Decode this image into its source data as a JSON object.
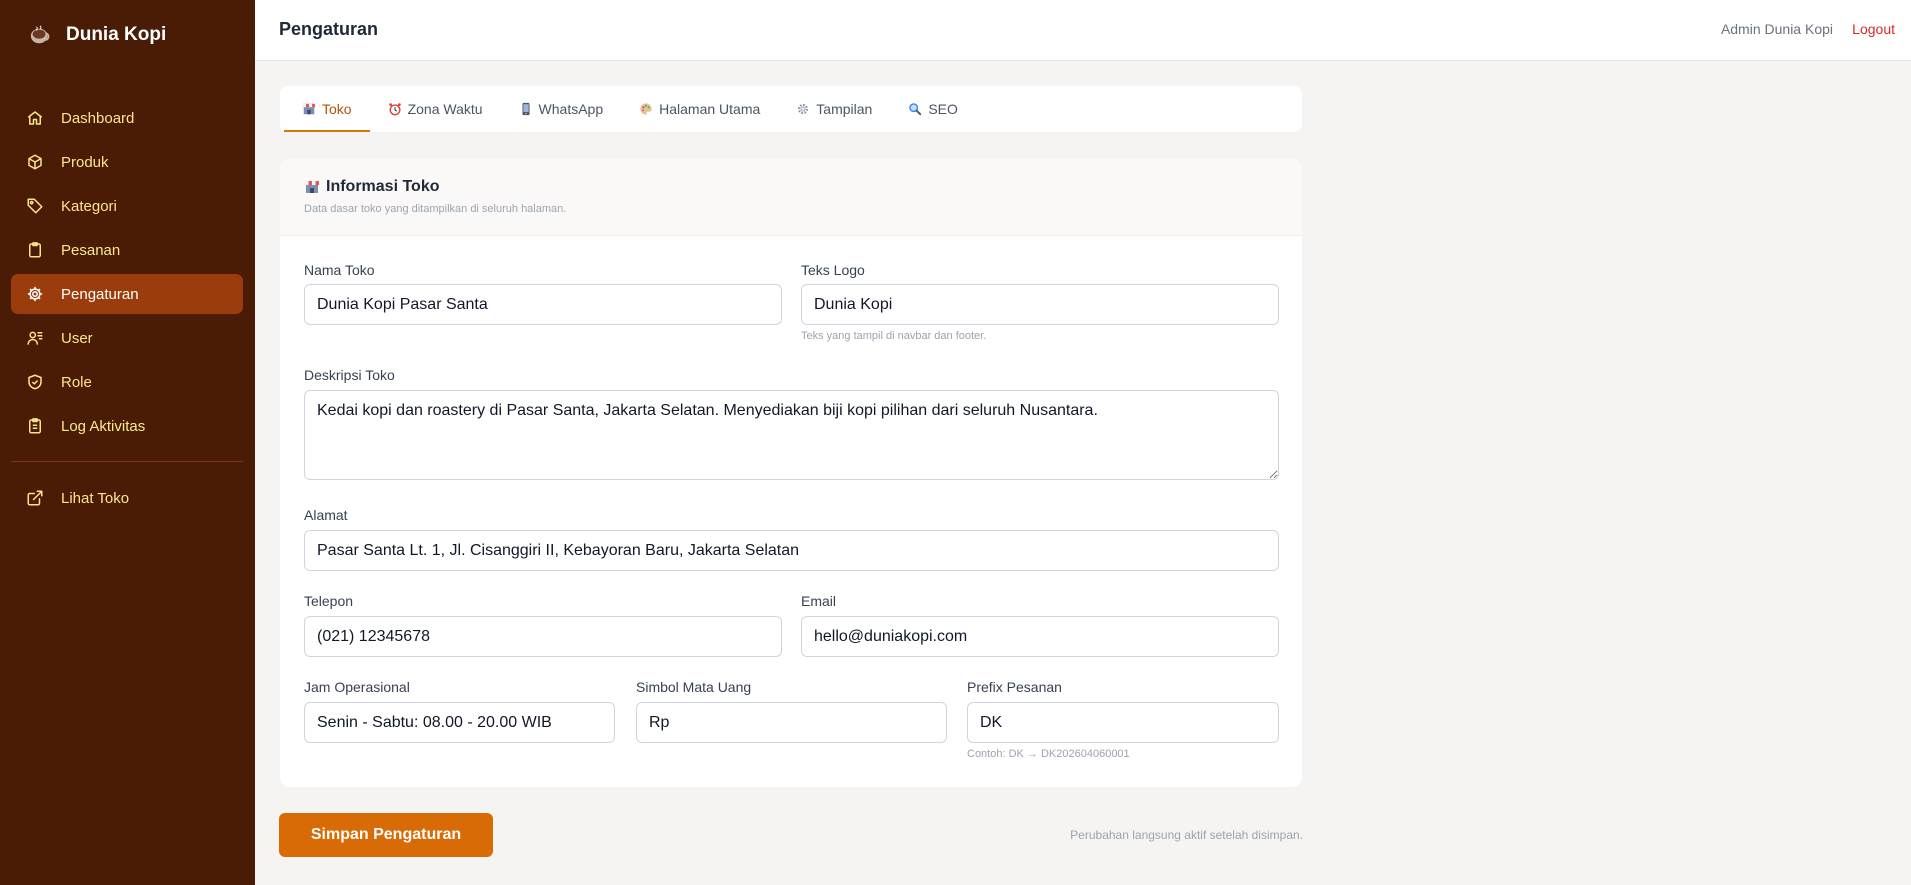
{
  "brand": {
    "name": "Dunia Kopi",
    "icon": "coffee-cup-icon"
  },
  "sidebar": {
    "items": [
      {
        "label": "Dashboard",
        "icon": "home-icon",
        "active": false
      },
      {
        "label": "Produk",
        "icon": "box-icon",
        "active": false
      },
      {
        "label": "Kategori",
        "icon": "tag-icon",
        "active": false
      },
      {
        "label": "Pesanan",
        "icon": "clipboard-icon",
        "active": false
      },
      {
        "label": "Pengaturan",
        "icon": "gear-icon",
        "active": true
      },
      {
        "label": "User",
        "icon": "users-icon",
        "active": false
      },
      {
        "label": "Role",
        "icon": "shield-icon",
        "active": false
      },
      {
        "label": "Log Aktivitas",
        "icon": "clipboard-list-icon",
        "active": false
      }
    ],
    "bottom": {
      "label": "Lihat Toko",
      "icon": "external-link-icon"
    }
  },
  "header": {
    "title": "Pengaturan",
    "admin_name": "Admin Dunia Kopi",
    "logout": "Logout"
  },
  "tabs": [
    {
      "label": "Toko",
      "icon": "store-icon",
      "active": true
    },
    {
      "label": "Zona Waktu",
      "icon": "alarm-clock-icon",
      "active": false
    },
    {
      "label": "WhatsApp",
      "icon": "phone-icon",
      "active": false
    },
    {
      "label": "Halaman Utama",
      "icon": "palette-icon",
      "active": false
    },
    {
      "label": "Tampilan",
      "icon": "gear-icon",
      "active": false
    },
    {
      "label": "SEO",
      "icon": "magnifier-icon",
      "active": false
    }
  ],
  "card": {
    "title": "Informasi Toko",
    "subtitle": "Data dasar toko yang ditampilkan di seluruh halaman."
  },
  "form": {
    "nama_toko": {
      "label": "Nama Toko",
      "value": "Dunia Kopi Pasar Santa"
    },
    "teks_logo": {
      "label": "Teks Logo",
      "value": "Dunia Kopi",
      "hint": "Teks yang tampil di navbar dan footer."
    },
    "deskripsi": {
      "label": "Deskripsi Toko",
      "value": "Kedai kopi dan roastery di Pasar Santa, Jakarta Selatan. Menyediakan biji kopi pilihan dari seluruh Nusantara."
    },
    "alamat": {
      "label": "Alamat",
      "value": "Pasar Santa Lt. 1, Jl. Cisanggiri II, Kebayoran Baru, Jakarta Selatan"
    },
    "telepon": {
      "label": "Telepon",
      "value": "(021) 12345678"
    },
    "email": {
      "label": "Email",
      "value": "hello@duniakopi.com"
    },
    "jam": {
      "label": "Jam Operasional",
      "value": "Senin - Sabtu: 08.00 - 20.00 WIB"
    },
    "simbol": {
      "label": "Simbol Mata Uang",
      "value": "Rp"
    },
    "prefix": {
      "label": "Prefix Pesanan",
      "value": "DK",
      "hint": "Contoh: DK → DK202604060001"
    }
  },
  "footer": {
    "save_label": "Simpan Pengaturan",
    "note": "Perubahan langsung aktif setelah disimpan."
  },
  "colors": {
    "sidebar": "#4a1c05",
    "active_nav": "#9a3c0c",
    "accent": "#d96b06",
    "logout": "#dc2626"
  }
}
